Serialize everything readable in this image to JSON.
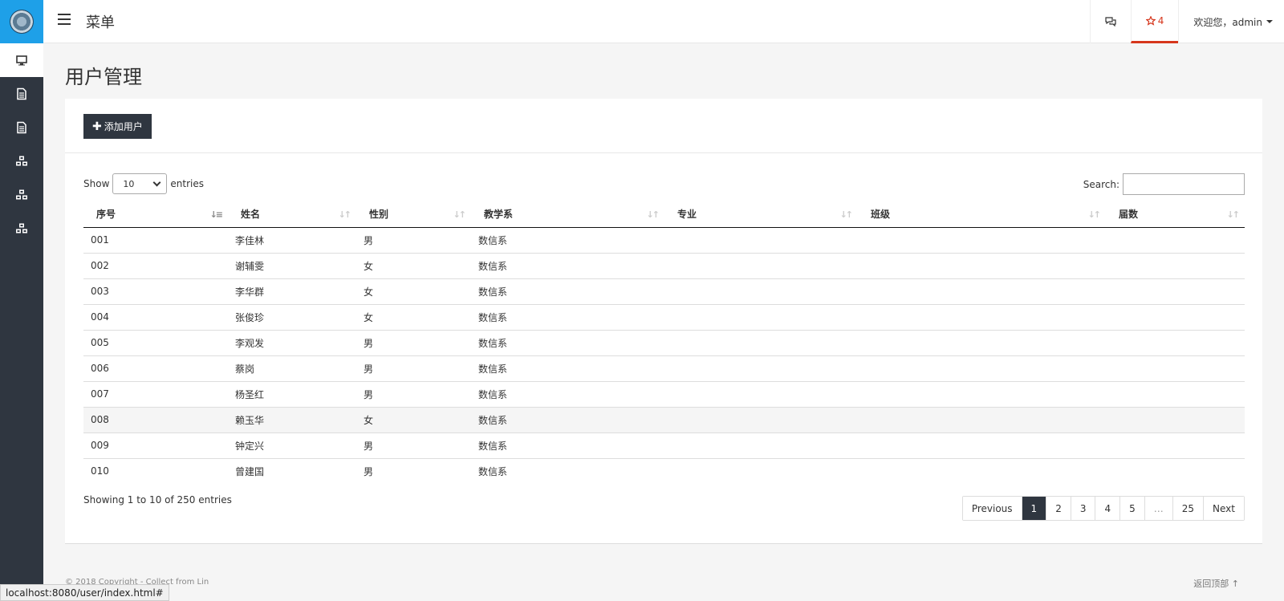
{
  "sidebar": {
    "items": [
      {
        "icon": "monitor-icon",
        "active": true
      },
      {
        "icon": "file-icon"
      },
      {
        "icon": "file-icon"
      },
      {
        "icon": "cubes-icon"
      },
      {
        "icon": "cubes-icon"
      },
      {
        "icon": "cubes-icon"
      }
    ]
  },
  "header": {
    "menu_title": "菜单",
    "alert_count": "4",
    "welcome": "欢迎您，admin"
  },
  "main": {
    "page_title": "用户管理",
    "add_button": "添加用户",
    "length": {
      "show": "Show",
      "value": "10",
      "entries": "entries"
    },
    "search_label": "Search:",
    "table": {
      "columns": [
        "序号",
        "姓名",
        "性别",
        "教学系",
        "专业",
        "班级",
        "届数"
      ],
      "rows": [
        [
          "001",
          "李佳林",
          "男",
          "数信系",
          "",
          "",
          ""
        ],
        [
          "002",
          "谢辅雯",
          "女",
          "数信系",
          "",
          "",
          ""
        ],
        [
          "003",
          "李华群",
          "女",
          "数信系",
          "",
          "",
          ""
        ],
        [
          "004",
          "张俊珍",
          "女",
          "数信系",
          "",
          "",
          ""
        ],
        [
          "005",
          "李观发",
          "男",
          "数信系",
          "",
          "",
          ""
        ],
        [
          "006",
          "蔡岗",
          "男",
          "数信系",
          "",
          "",
          ""
        ],
        [
          "007",
          "杨圣红",
          "男",
          "数信系",
          "",
          "",
          ""
        ],
        [
          "008",
          "赖玉华",
          "女",
          "数信系",
          "",
          "",
          ""
        ],
        [
          "009",
          "钟定兴",
          "男",
          "数信系",
          "",
          "",
          ""
        ],
        [
          "010",
          "曾建国",
          "男",
          "数信系",
          "",
          "",
          ""
        ]
      ]
    },
    "info": "Showing 1 to 10 of 250 entries",
    "pager": [
      "Previous",
      "1",
      "2",
      "3",
      "4",
      "5",
      "…",
      "25",
      "Next"
    ],
    "pager_current": "1"
  },
  "footer": {
    "left": "© 2018 Copyright - Collect from Lin",
    "right": "返回顶部"
  },
  "status_url": "localhost:8080/user/index.html#"
}
